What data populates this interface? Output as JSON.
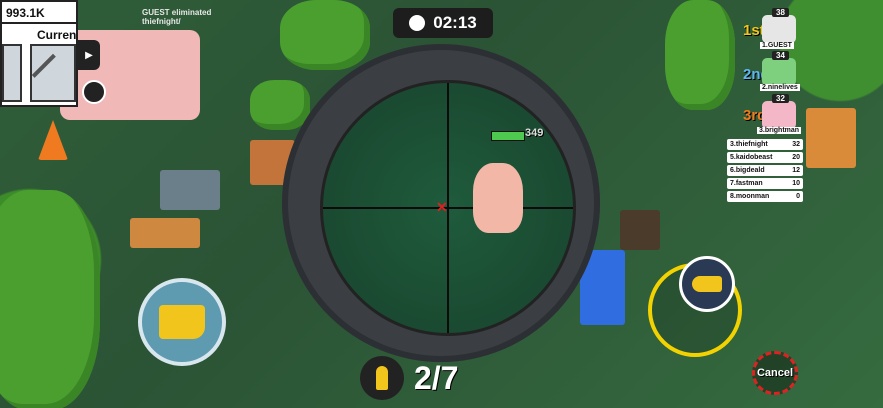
{
  "hud": {
    "timer": "02:13",
    "ammo": "2/7",
    "cancel_label": "Cancel",
    "kill_feed": {
      "killer": "GUEST eliminated",
      "victim": "thiefnight/"
    },
    "coins": "993.1K",
    "weapon_tab_label": "Curren",
    "health_text": "349"
  },
  "leaderboard": {
    "top3": [
      {
        "rank_label": "1st",
        "kills": "38",
        "name": "1.GUEST"
      },
      {
        "rank_label": "2nd",
        "kills": "34",
        "name": "2.ninelives"
      },
      {
        "rank_label": "3rd",
        "kills": "32",
        "name": "3.brightman"
      }
    ],
    "rows": [
      {
        "name": "3.thiefnight",
        "score": "32"
      },
      {
        "name": "5.kaidobeast",
        "score": "20"
      },
      {
        "name": "6.bigdeald",
        "score": "12"
      },
      {
        "name": "7.fastman",
        "score": "10"
      },
      {
        "name": "8.moonman",
        "score": "0"
      }
    ]
  },
  "colors": {
    "accent_yellow": "#f2c51c",
    "scope_ring": "#3b3f44",
    "crosshair_red": "#e02020"
  }
}
